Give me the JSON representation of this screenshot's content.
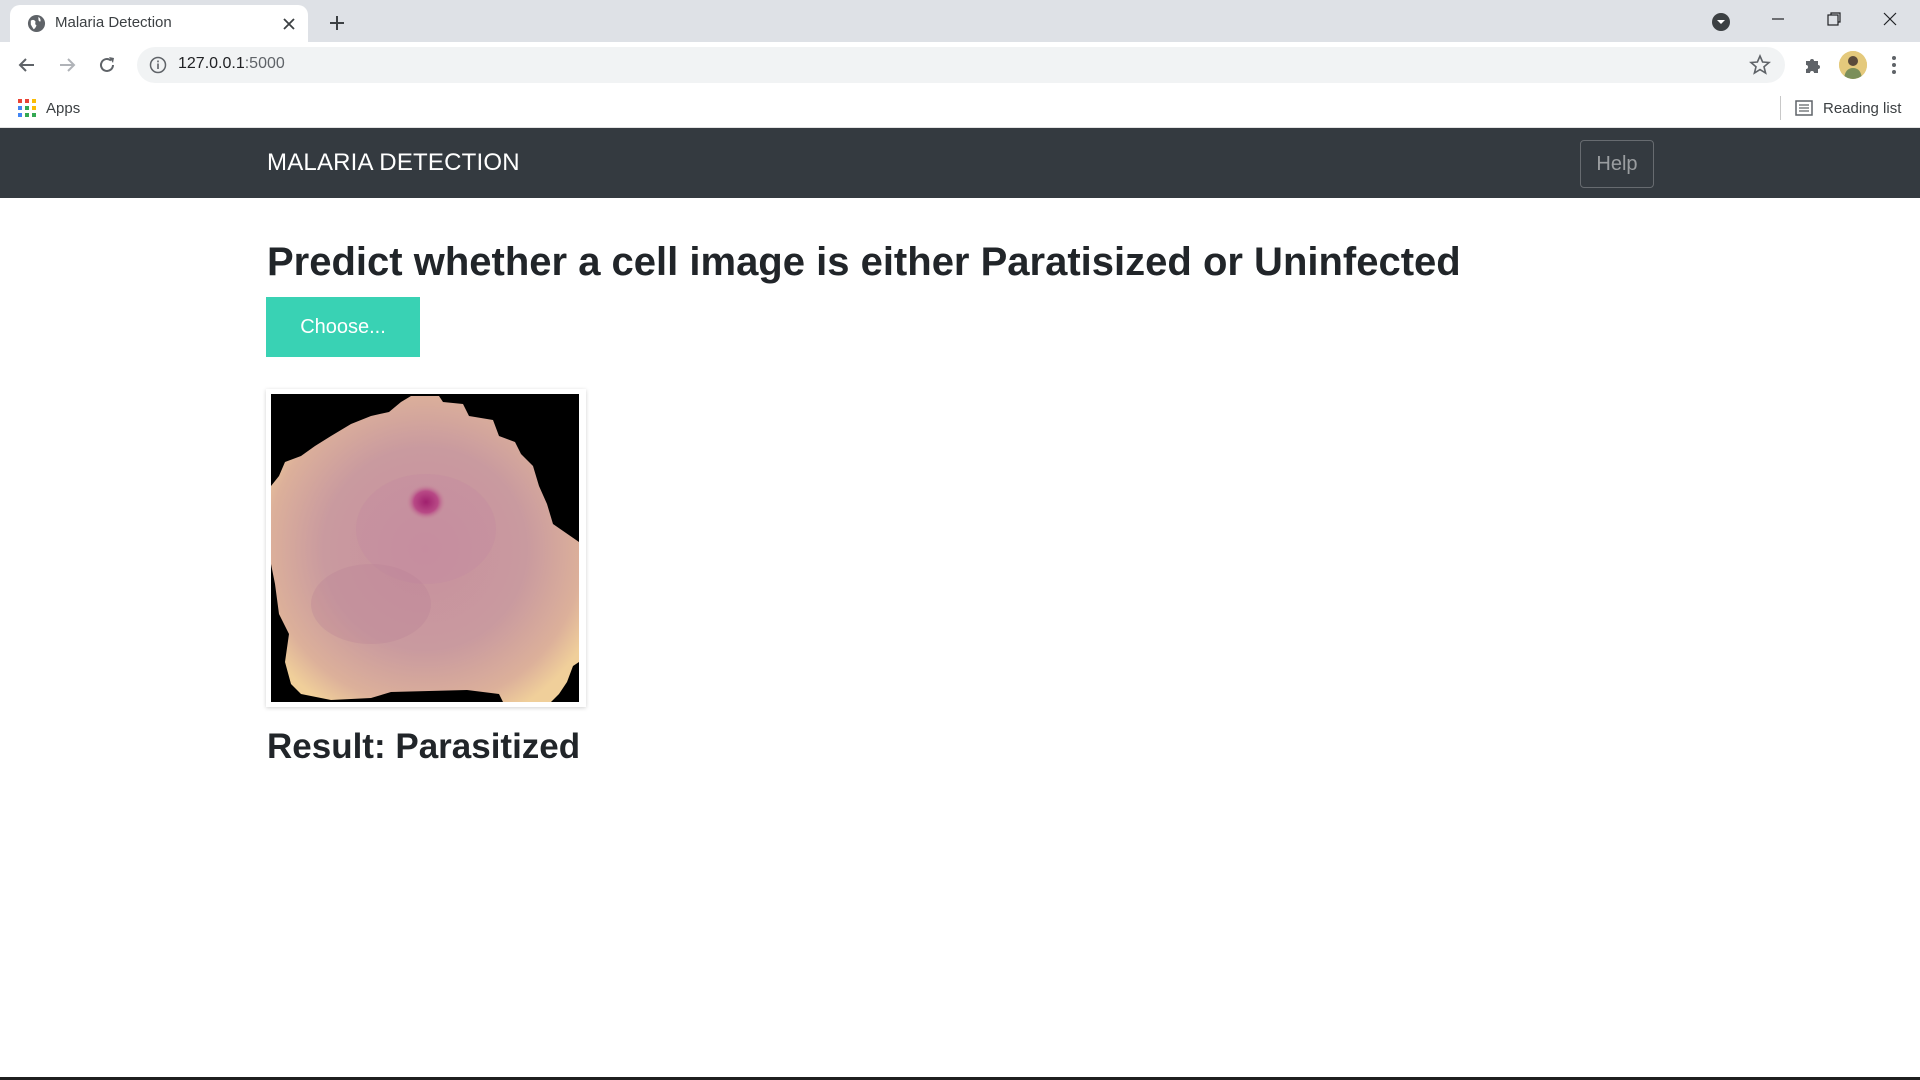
{
  "browser": {
    "tab_title": "Malaria Detection",
    "url_host": "127.0.0.1",
    "url_port": ":5000",
    "bookmarks": {
      "apps_label": "Apps",
      "reading_list_label": "Reading list"
    },
    "icons": {
      "favicon": "globe-icon",
      "tab_close": "close-icon",
      "new_tab": "plus-icon",
      "tab_search": "tab-search-icon",
      "back": "arrow-left-icon",
      "forward": "arrow-right-icon",
      "reload": "reload-icon",
      "site_info": "info-icon",
      "bookmark_star": "star-icon",
      "extensions": "puzzle-icon",
      "menu": "kebab-menu-icon",
      "apps": "apps-grid-icon",
      "reading_list": "reading-list-icon"
    }
  },
  "navbar": {
    "brand": "MALARIA DETECTION",
    "help_label": "Help"
  },
  "main": {
    "heading": "Predict whether a cell image is either Paratisized or Uninfected",
    "choose_label": "Choose...",
    "result_text": "Result: Parasitized"
  },
  "colors": {
    "navbar_bg": "#343a40",
    "accent": "#39d2b4",
    "text": "#212529"
  }
}
